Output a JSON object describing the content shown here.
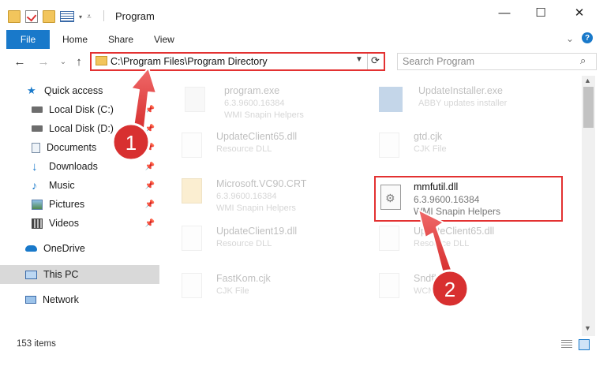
{
  "window": {
    "title": "Program",
    "minimize": "—",
    "maximize": "☐",
    "close": "✕"
  },
  "ribbon": {
    "tabs": [
      "File",
      "Home",
      "Share",
      "View"
    ],
    "help": "?"
  },
  "nav": {
    "back": "←",
    "forward": "→",
    "recent": "⌄",
    "up": "↑",
    "address": "C:\\Program Files\\Program Directory",
    "search_placeholder": "Search Program"
  },
  "sidebar": {
    "items": [
      {
        "label": "Quick access",
        "icon": "star-icon",
        "pinned": false
      },
      {
        "label": "Local Disk (C:)",
        "icon": "drive-icon",
        "pinned": true
      },
      {
        "label": "Local Disk (D:)",
        "icon": "drive-icon",
        "pinned": true
      },
      {
        "label": "Documents",
        "icon": "documents-icon",
        "pinned": true
      },
      {
        "label": "Downloads",
        "icon": "download-icon",
        "pinned": true
      },
      {
        "label": "Music",
        "icon": "music-icon",
        "pinned": true
      },
      {
        "label": "Pictures",
        "icon": "pictures-icon",
        "pinned": true
      },
      {
        "label": "Videos",
        "icon": "videos-icon",
        "pinned": true
      },
      {
        "label": "OneDrive",
        "icon": "cloud-icon",
        "pinned": false
      },
      {
        "label": "This PC",
        "icon": "computer-icon",
        "pinned": false,
        "selected": true
      },
      {
        "label": "Network",
        "icon": "network-icon",
        "pinned": false
      }
    ]
  },
  "files": [
    {
      "name": "program.exe",
      "line1": "6.3.9600.16384",
      "line2": "WMI Snapin Helpers",
      "faded": true
    },
    {
      "name": "UpdateInstaller.exe",
      "line1": "ABBY updates installer",
      "line2": "",
      "faded": true
    },
    {
      "name": "UpdateClient65.dll",
      "line1": "Resource DLL",
      "line2": "",
      "faded": true
    },
    {
      "name": "gtd.cjk",
      "line1": "CJK File",
      "line2": "",
      "faded": true
    },
    {
      "name": "Microsoft.VC90.CRT",
      "line1": "6.3.9600.16384",
      "line2": "WMI Snapin Helpers",
      "faded": true
    },
    {
      "name": "mmfutil.dll",
      "line1": "6.3.9600.16384",
      "line2": "WMI Snapin Helpers",
      "faded": false
    },
    {
      "name": "UpdateClient19.dll",
      "line1": "Resource DLL",
      "line2": "",
      "faded": true
    },
    {
      "name": "UpdateClient65.dll",
      "line1": "Resource DLL",
      "line2": "",
      "faded": true
    },
    {
      "name": "FastKom.cjk",
      "line1": "CJK File",
      "line2": "",
      "faded": true
    },
    {
      "name": "Sndflc.wcm",
      "line1": "WCM File",
      "line2": "",
      "faded": true
    }
  ],
  "callouts": [
    "1",
    "2"
  ],
  "status": {
    "item_count": "153 items"
  },
  "colors": {
    "accent": "#1979ca",
    "highlight": "#e33131"
  }
}
